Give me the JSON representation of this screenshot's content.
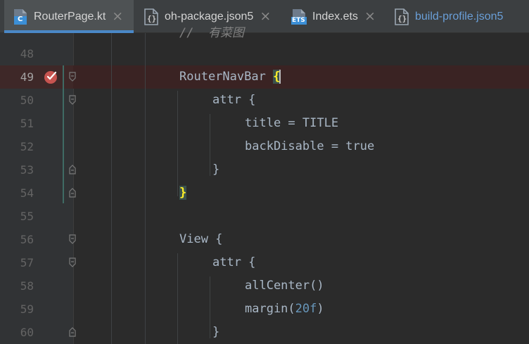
{
  "tabs": [
    {
      "label": "RouterPage.kt",
      "icon": "kotlin-class-icon",
      "active": true
    },
    {
      "label": "oh-package.json5",
      "icon": "json-file-icon",
      "active": false
    },
    {
      "label": "Index.ets",
      "icon": "ets-file-icon",
      "active": false
    },
    {
      "label": "build-profile.json5",
      "icon": "json-file-icon",
      "active": false
    }
  ],
  "tab_close_glyph": "×",
  "icon_texts": {
    "kotlin": "C",
    "json": "{}",
    "ets": "ETS"
  },
  "colors": {
    "background": "#2b2b2b",
    "gutter": "#313335",
    "tabbar": "#3c3f41",
    "active_tab_underline": "#4a88c7",
    "breakpoint_line": "#3a2323",
    "breakpoint": "#c75450",
    "brace_match": "#ffef28",
    "number": "#6897bb",
    "code_text": "#a9b7c6",
    "vcs_change": "#3f6b64"
  },
  "editor": {
    "partial_top_line": "//  有菜图",
    "lines": [
      {
        "number": "48",
        "text": ""
      },
      {
        "number": "49",
        "text": "RouterNavBar ",
        "brace": "{",
        "breakpoint": true
      },
      {
        "number": "50",
        "text": "attr {"
      },
      {
        "number": "51",
        "text": "title = TITLE"
      },
      {
        "number": "52",
        "text": "backDisable = true"
      },
      {
        "number": "53",
        "text": "}"
      },
      {
        "number": "54",
        "brace": "}"
      },
      {
        "number": "55",
        "text": ""
      },
      {
        "number": "56",
        "text": "View {"
      },
      {
        "number": "57",
        "text": "attr {"
      },
      {
        "number": "58",
        "text": "allCenter()"
      },
      {
        "number": "59",
        "text": "margin(",
        "number_literal": "20f",
        "text_after": ")"
      },
      {
        "number": "60",
        "text": "}"
      }
    ]
  }
}
